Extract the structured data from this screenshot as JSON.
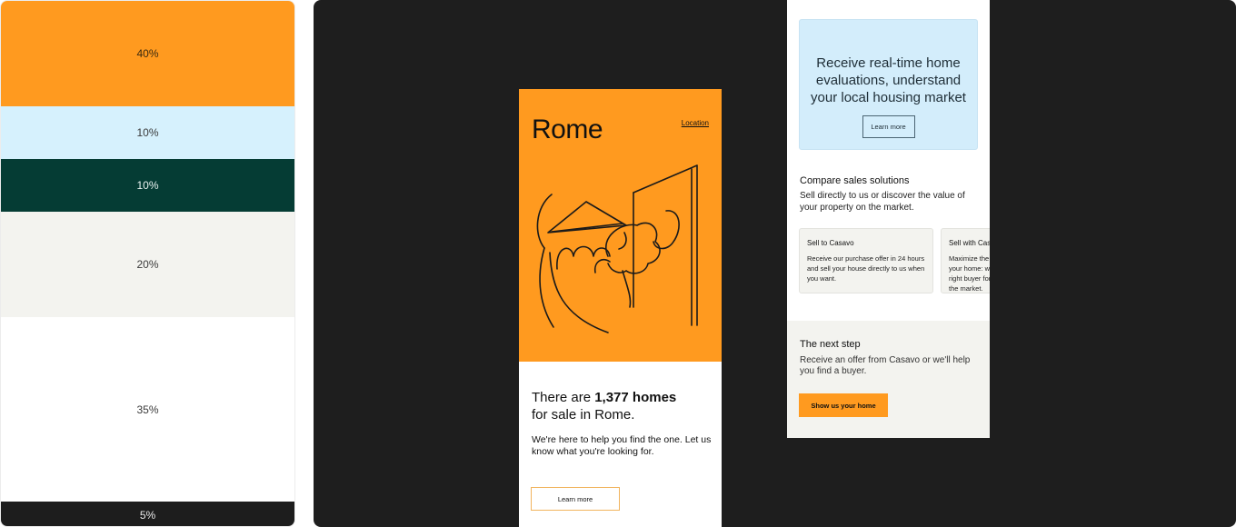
{
  "palette": {
    "swatches": [
      {
        "label": "40%",
        "color": "#ff9a1f"
      },
      {
        "label": "10%",
        "color": "#d6f1fd"
      },
      {
        "label": "10%",
        "color": "#053c34"
      },
      {
        "label": "20%",
        "color": "#f3f3ef"
      },
      {
        "label": "35%",
        "color": "#ffffff"
      },
      {
        "label": "5%",
        "color": "#1d1d1d"
      }
    ]
  },
  "rome_card": {
    "city": "Rome",
    "location_link": "Location",
    "headline_prefix": "There are ",
    "headline_count": "1,377 homes",
    "headline_suffix": "for sale in Rome.",
    "subtext": "We're here to help you find the one. Let us know what you're looking for.",
    "button_label": "Learn more"
  },
  "right_card": {
    "evaluation": {
      "text": "Receive real-time home evaluations, understand your local housing market",
      "button_label": "Learn more"
    },
    "compare": {
      "title": "Compare sales solutions",
      "subtitle": "Sell directly to us or discover the value of your property on the market.",
      "solutions": [
        {
          "title": "Sell to Casavo",
          "description": "Receive our purchase offer in 24 hours and sell your house directly to us when you want."
        },
        {
          "title": "Sell with Casavo",
          "description": "Maximize the value of your home: we find the right buyer for you on the market."
        }
      ]
    },
    "next_step": {
      "title": "The next step",
      "subtitle": "Receive an offer from Casavo or we'll help you find a buyer.",
      "button_label": "Show us your home"
    }
  }
}
